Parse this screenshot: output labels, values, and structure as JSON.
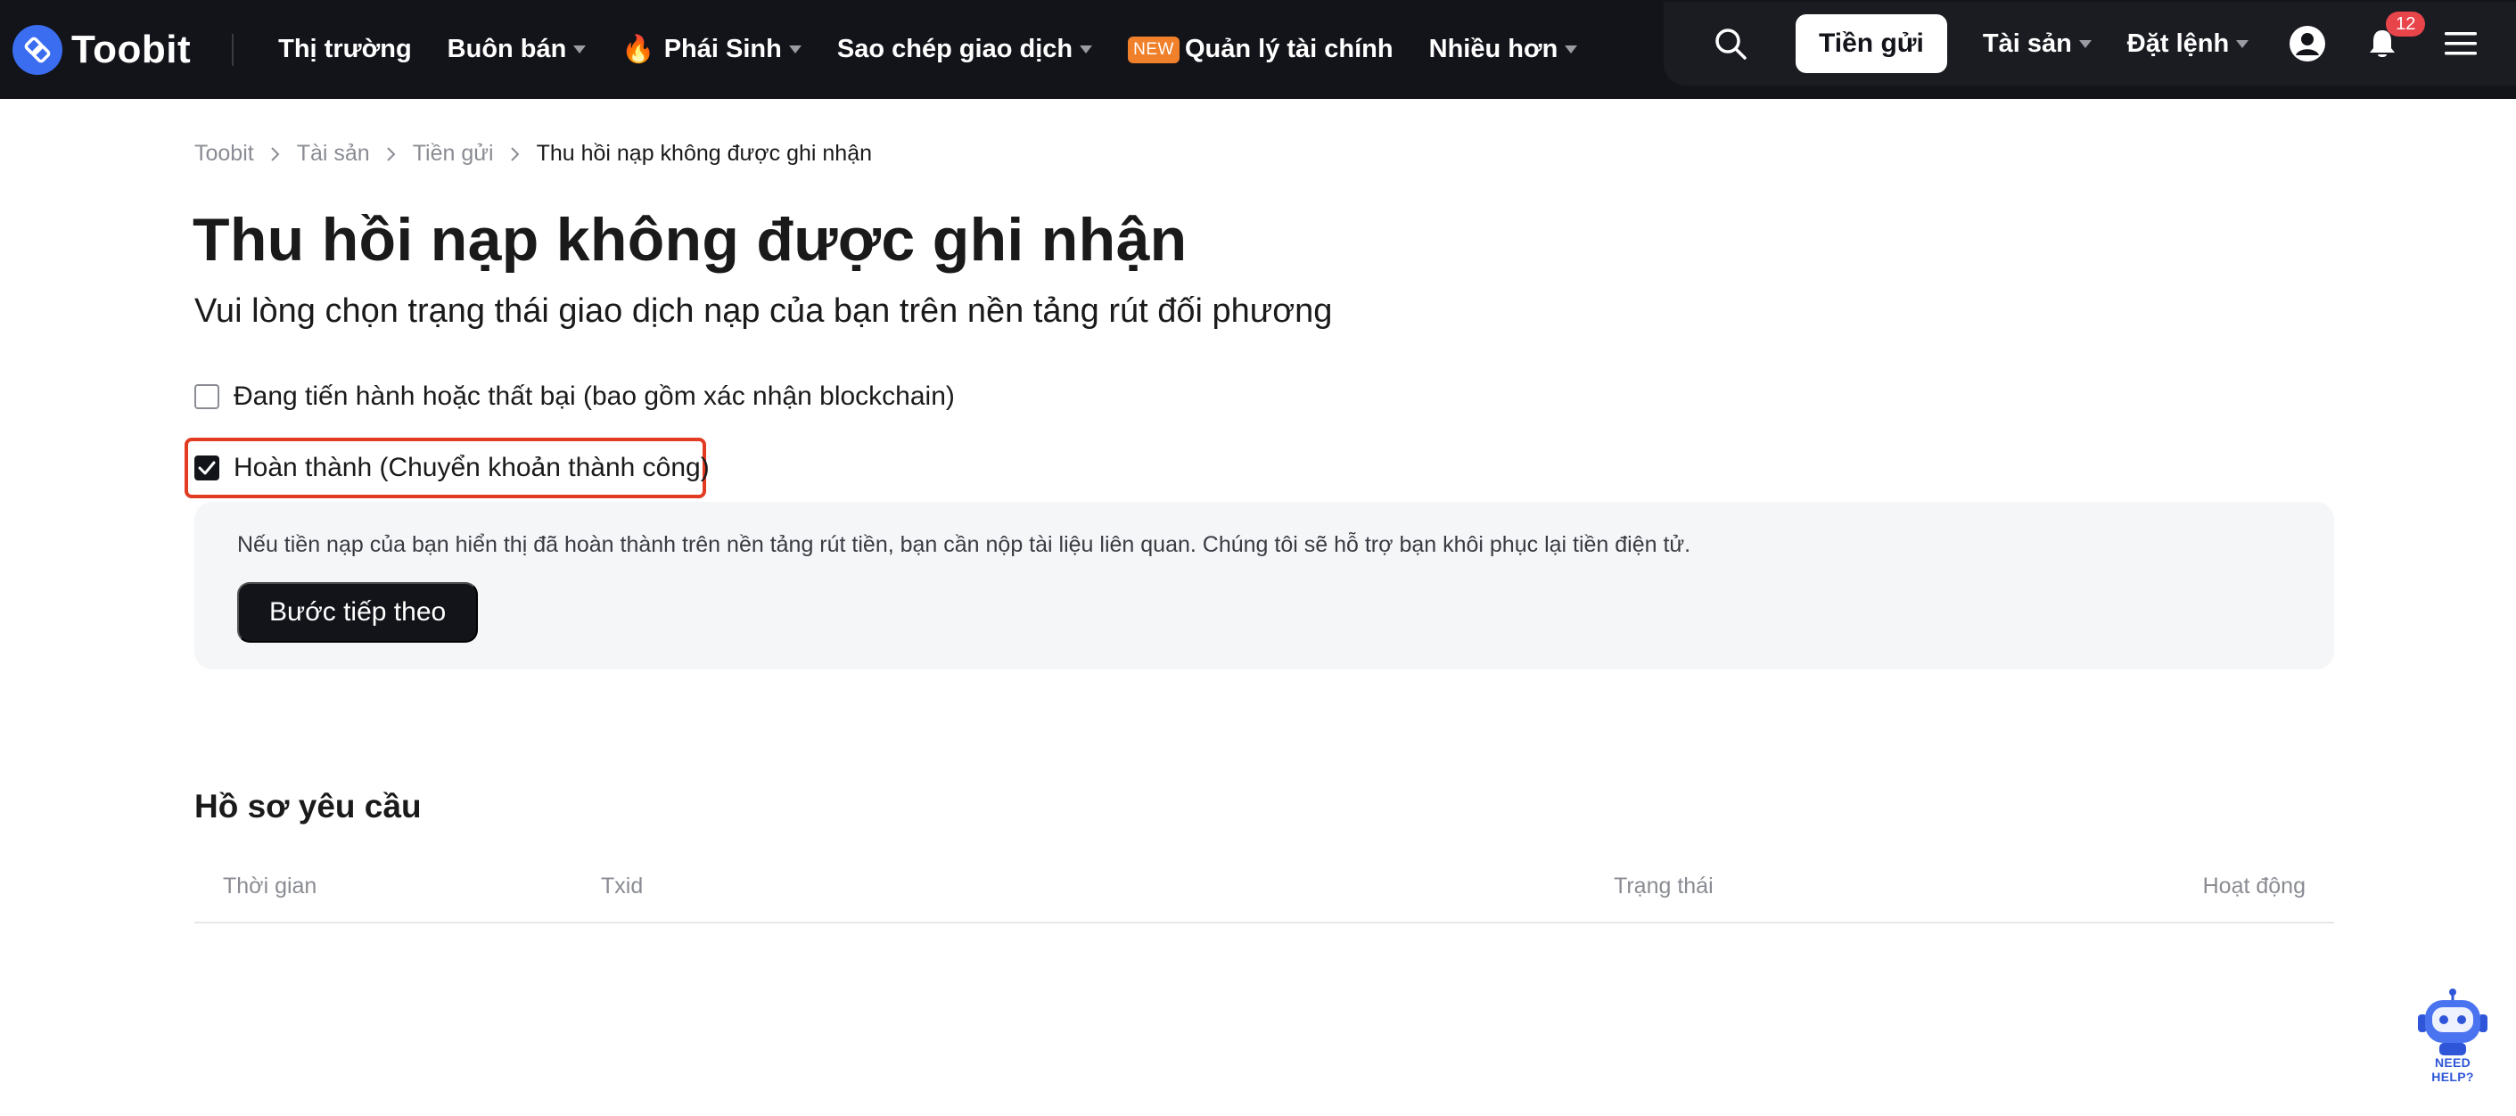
{
  "brand": {
    "name": "Toobit"
  },
  "nav": {
    "items": [
      {
        "label": "Thị trường",
        "dropdown": false
      },
      {
        "label": "Buôn bán",
        "dropdown": true
      },
      {
        "label": "Phái Sinh",
        "dropdown": true,
        "icon": "fire-icon"
      },
      {
        "label": "Sao chép giao dịch",
        "dropdown": true
      },
      {
        "label": "Quản lý tài chính",
        "dropdown": false,
        "badge": "NEW"
      },
      {
        "label": "Nhiều hơn",
        "dropdown": true
      }
    ],
    "deposit_label": "Tiền gửi",
    "assets_label": "Tài sản",
    "orders_label": "Đặt lệnh",
    "notification_count": "12"
  },
  "breadcrumb": [
    "Toobit",
    "Tài sản",
    "Tiền gửi",
    "Thu hồi nạp không được ghi nhận"
  ],
  "page": {
    "title": "Thu hồi nạp không được ghi nhận",
    "subtitle": "Vui lòng chọn trạng thái giao dịch nạp của bạn trên nền tảng rút đối phương"
  },
  "options": [
    {
      "label": "Đang tiến hành hoặc thất bại (bao gồm xác nhận blockchain)",
      "checked": false
    },
    {
      "label": "Hoàn thành (Chuyển khoản thành công)",
      "checked": true
    }
  ],
  "info": {
    "text": "Nếu tiền nạp của bạn hiển thị đã hoàn thành trên nền tảng rút tiền, bạn cần nộp tài liệu liên quan. Chúng tôi sẽ hỗ trợ bạn khôi phục lại tiền điện tử.",
    "next_label": "Bước tiếp theo"
  },
  "records": {
    "title": "Hồ sơ yêu cầu",
    "columns": [
      "Thời gian",
      "Txid",
      "Trạng thái",
      "Hoạt động"
    ]
  },
  "help": {
    "label": "NEED HELP?"
  },
  "colors": {
    "nav_bg": "#13141a",
    "accent": "#3a6df0",
    "highlight": "#e23b22",
    "badge_new": "#f0802a",
    "badge_notification": "#e8454b"
  }
}
